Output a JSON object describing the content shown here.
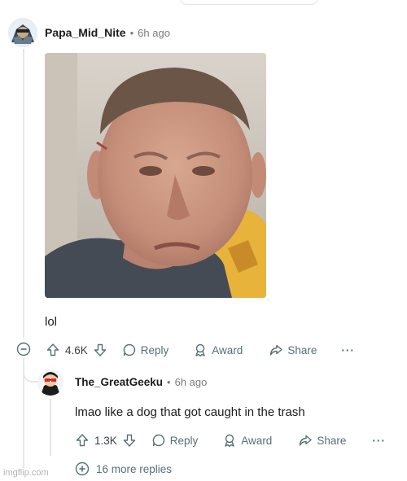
{
  "comment": {
    "username": "Papa_Mid_Nite",
    "separator": "•",
    "time": "6h ago",
    "text": "lol",
    "votes": "4.6K",
    "reply_label": "Reply",
    "award_label": "Award",
    "share_label": "Share",
    "more_label": "···"
  },
  "reply": {
    "username": "The_GreatGeeku",
    "separator": "•",
    "time": "6h ago",
    "text": "lmao like a dog that got caught in the trash",
    "votes": "1.3K",
    "reply_label": "Reply",
    "award_label": "Award",
    "share_label": "Share",
    "more_label": "···"
  },
  "more_replies": "16 more replies",
  "watermark": "imgflip.com",
  "colors": {
    "text": "#1c1c1c",
    "meta": "#7c7c7c",
    "action": "#576f76",
    "thread_line": "#e4e6e8"
  }
}
